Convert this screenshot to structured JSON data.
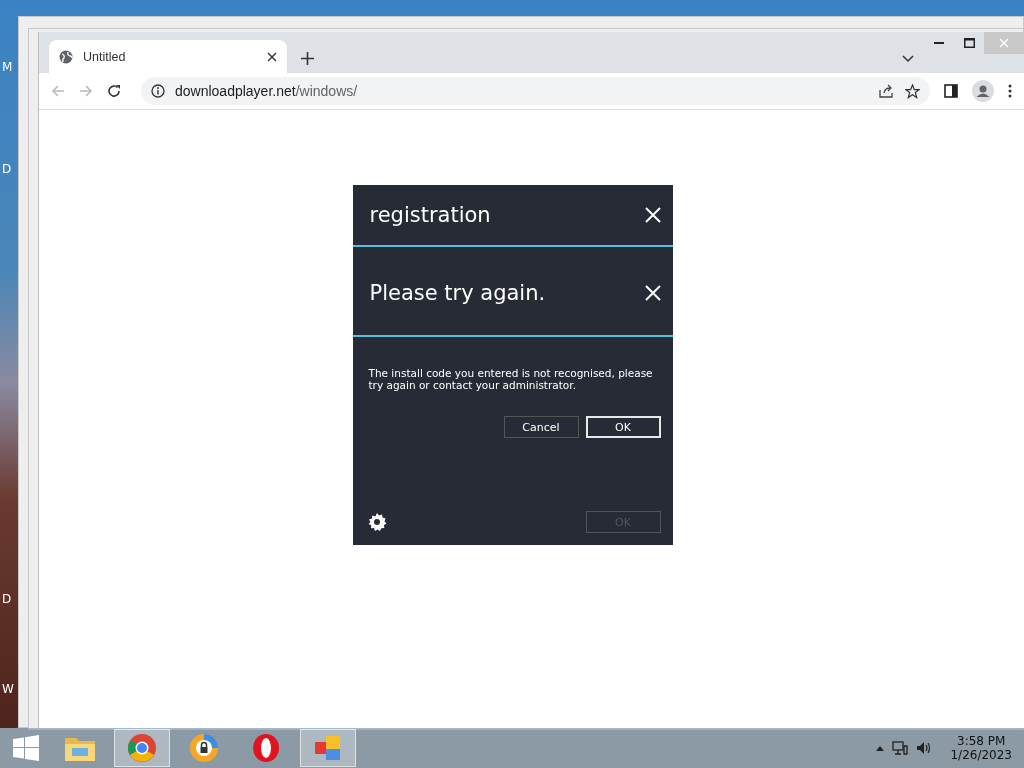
{
  "desktop": {
    "icon_labels": [
      "M",
      "D",
      "D",
      "W"
    ]
  },
  "browser": {
    "tab": {
      "title": "Untitled",
      "selected": true
    },
    "url": {
      "domain": "downloadplayer.net",
      "path": "/windows/"
    }
  },
  "dialog": {
    "title": "registration",
    "subtitle": "Please try again.",
    "message": "The install code you entered is not recognised, please try again or contact your administrator.",
    "buttons": [
      {
        "label": "Cancel",
        "kind": "secondary"
      },
      {
        "label": "OK",
        "kind": "primary"
      }
    ],
    "footer_button": {
      "label": "OK",
      "disabled": true
    }
  },
  "taskbar": {
    "apps": [
      {
        "kind": "folder",
        "active": false
      },
      {
        "kind": "chrome",
        "active": true
      },
      {
        "kind": "lock-browser",
        "active": false
      },
      {
        "kind": "opera",
        "active": false
      },
      {
        "kind": "tiles",
        "active": true
      }
    ],
    "time": "3:58 PM",
    "date": "1/26/2023"
  }
}
